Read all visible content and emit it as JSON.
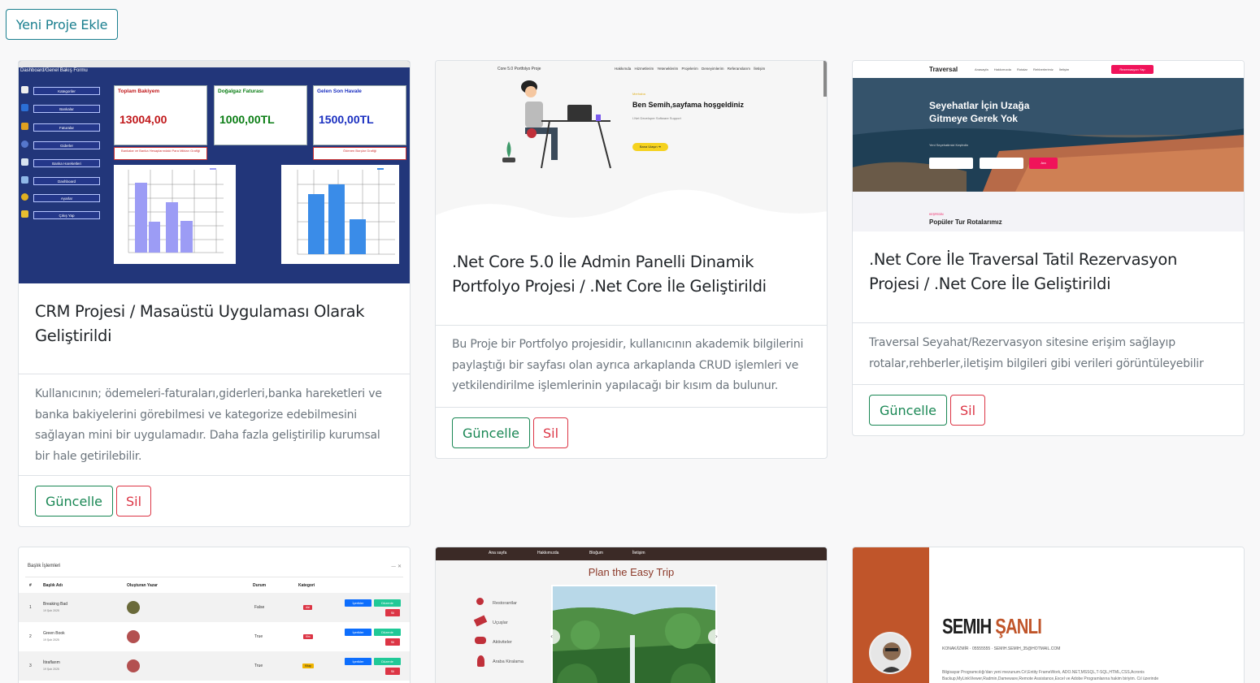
{
  "header": {
    "add_button": "Yeni Proje Ekle"
  },
  "buttons": {
    "update": "Güncelle",
    "delete": "Sil"
  },
  "projects": [
    {
      "title": "CRM Projesi / Masaüstü Uygulaması Olarak Geliştirildi",
      "description": "Kullanıcının; ödemeleri-faturaları,giderleri,banka hareketleri ve banka bakiyelerini görebilmesi ve kategorize edebilmesini sağlayan mini bir uygulamadır. Daha fazla geliştirilip kurumsal bir hale getirilebilir.",
      "thumb": {
        "window_title": "Dashboard",
        "header": "Dashboard/Genel Bakış Formu",
        "menu": [
          "Kategoriler",
          "Bankalar",
          "Faturalar",
          "Giderler",
          "Banka Hareketleri",
          "Dashboard",
          "Ayarlar",
          "Çıkış Yap"
        ],
        "stats": [
          {
            "label": "Toplam Bakiyem",
            "value": "13004,00",
            "color": "#c0171a"
          },
          {
            "label": "Doğalgaz Faturası",
            "value": "1000,00TL",
            "color": "#0a7d14"
          },
          {
            "label": "Gelen Son Havale",
            "value": "1500,00TL",
            "color": "#1a2fc0"
          }
        ],
        "notes": [
          "Bankalar ve Banka Hesaplarındaki Para Miktarı Grafiği",
          "Ödenen Borçlar Grafiği"
        ]
      }
    },
    {
      "title": ".Net Core 5.0 İle Admin Panelli Dinamik Portfolyo Projesi / .Net Core İle Geliştirildi",
      "description": "Bu Proje bir Portfolyo projesidir, kullanıcının akademik bilgilerini paylaştığı bir sayfası olan ayrıca arkaplanda CRUD işlemleri ve yetkilendirilme işlemlerinin yapılacağı bir kısım da bulunur.",
      "thumb": {
        "brand": "Core 5.0 Portfolyo Proje",
        "nav": "Hakkımda Hizmetlerim Yeteneklerim Projelerim Deneyimlerim Referanslarım İletişim",
        "greeting": "Merhaba",
        "heading": "Ben Semih,sayfama hoşgeldiniz",
        "subheading": "I.Net Developer Software Support",
        "cta": "Bana Ulaşın ➜"
      }
    },
    {
      "title": ".Net Core İle Traversal Tatil Rezervasyon Projesi / .Net Core İle Geliştirildi",
      "description": "Traversal Seyahat/Rezervasyon sitesine erişim sağlayıp rotalar,rehberler,iletişim bilgileri gibi verileri görüntüleyebilir",
      "thumb": {
        "brand": "Traversal",
        "nav": "Anasayfa Hakkımızda Rotalar Rehberlerimiz İletişim",
        "cta": "Rezervasyon Yap",
        "hero": "Seyehatlar İçin Uzağa Gitmeye Gerek Yok",
        "hero_sub": "Yeni Seyehatimizi Keşfedin",
        "search_btn": "Ara",
        "section_kicker": "KEŞFEDİN",
        "section_title": "Popüler Tur Rotalarımız"
      }
    },
    {
      "thumb": {
        "header": "Başlık İşlemleri",
        "columns": [
          "#",
          "Başlık Adı",
          "Oluşturan Yazar",
          "Durum",
          "Kategori"
        ],
        "rows": [
          {
            "no": "1",
            "name": "Breaking Bad",
            "date": "19 Şub 2025",
            "status": "False",
            "cat": "dizi",
            "cat_color": "#dc3545"
          },
          {
            "no": "2",
            "name": "Green Book",
            "date": "19 Şub 2025",
            "status": "True",
            "cat": "film",
            "cat_color": "#dc3545"
          },
          {
            "no": "3",
            "name": "İtiraflarım",
            "date": "19 Şub 2025",
            "status": "True",
            "cat": "Kitap",
            "cat_color": "#f0b400"
          }
        ],
        "btn_contents": "İçerikler",
        "btn_edit": "Düzenle",
        "btn_delete": "Sil"
      }
    },
    {
      "thumb": {
        "links": [
          "Ana sayfa",
          "Hakkımızda",
          "Bloğum",
          "İletişim"
        ],
        "title": "Plan the Easy Trip",
        "menu": [
          "Restorantlar",
          "Uçuşlar",
          "Aktiviteler",
          "Araba Kiralama"
        ]
      }
    },
    {
      "thumb": {
        "name_first": "SEMIH",
        "name_last": "ŞANLI",
        "contact": "KONAK/İZMİR · 05555555 · SEMIH.SEMIH_35@HOTMAIL.COM",
        "summary": "Bilgisayar Programcılığı'dan yeni mezunum.C#,Entity FrameWork, ADO.NET,MSSQL,T-SQL,HTML,CSS,Acronis Backup,MyLinkViewer,Radmin,Dameware,Remote Assistance,Excel ve Adobe Programlarına hakim biriyim. Cıl üzerinde"
      }
    }
  ]
}
